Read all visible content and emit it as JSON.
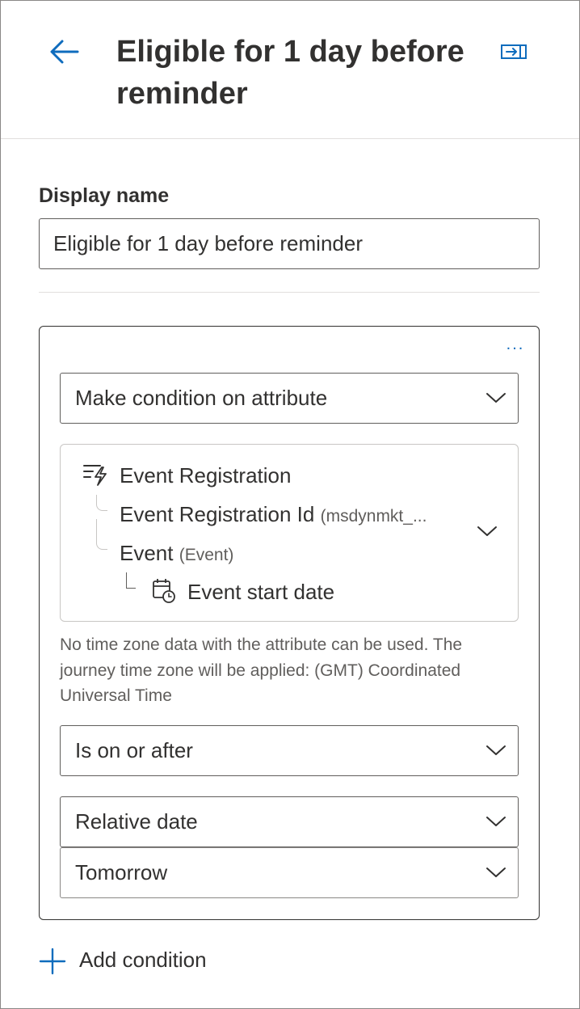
{
  "header": {
    "title": "Eligible for 1 day before reminder",
    "back_icon": "arrow-left-icon",
    "collapse_icon": "panel-collapse-icon",
    "accent_color": "#0f6cbd"
  },
  "display_name": {
    "label": "Display name",
    "value": "Eligible for 1 day before reminder"
  },
  "condition_card": {
    "more_label": "...",
    "condition_type": "Make condition on attribute",
    "attribute_path": {
      "root": "Event Registration",
      "root_icon": "trigger-event-icon",
      "items": [
        {
          "label": "Event Registration Id",
          "sub": "(msdynmkt_..."
        },
        {
          "label": "Event",
          "sub": "(Event)"
        }
      ],
      "leaf": "Event start date",
      "leaf_icon": "calendar-clock-icon"
    },
    "timezone_note": "No time zone data with the attribute can be used. The journey time zone will be applied: (GMT) Coordinated Universal Time",
    "operator": "Is on or after",
    "value_type": "Relative date",
    "relative_value": "Tomorrow"
  },
  "add_condition": {
    "label": "Add condition",
    "icon": "plus-icon"
  }
}
